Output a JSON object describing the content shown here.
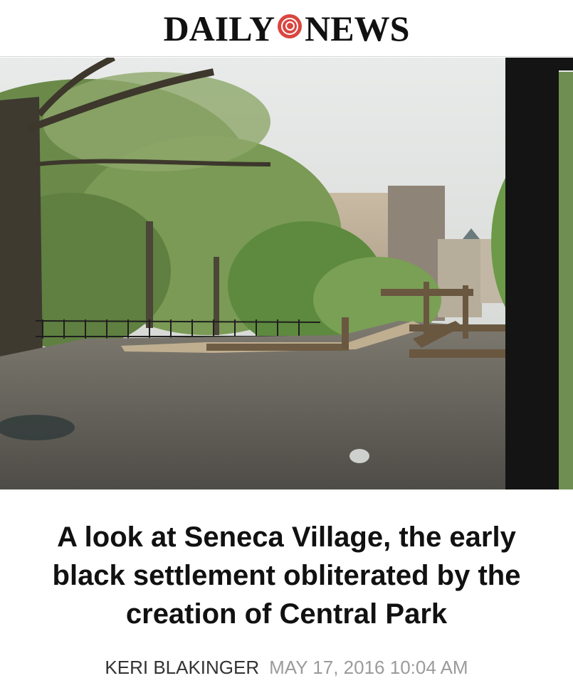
{
  "masthead": {
    "brand_left": "DAILY",
    "brand_right": "NEWS"
  },
  "photo": {
    "subject": "park-playground-photo"
  },
  "article": {
    "headline": "A look at Seneca Village, the early black settlement obliterated by the creation of Central Park",
    "author": "KERI BLAKINGER",
    "date": "MAY 17, 2016 10:04 AM"
  },
  "colors": {
    "seal": "#d9463f",
    "headline": "#111111",
    "date": "#9b9b9b"
  }
}
